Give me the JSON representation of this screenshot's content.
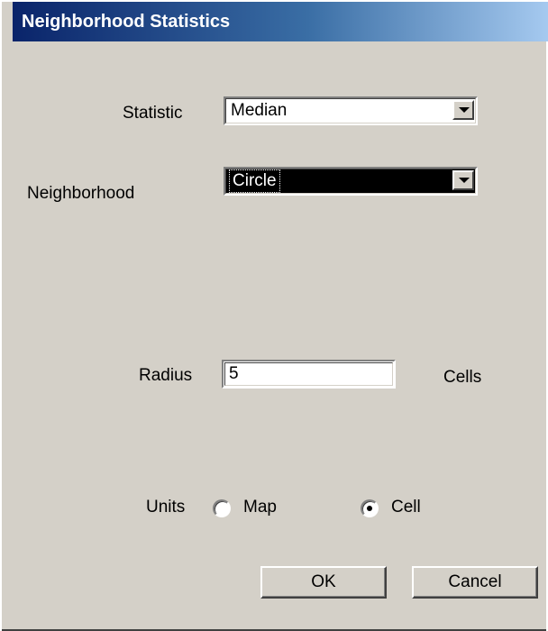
{
  "window": {
    "title": "Neighborhood Statistics"
  },
  "statistic": {
    "label": "Statistic",
    "value": "Median"
  },
  "neighborhood": {
    "label": "Neighborhood",
    "value": "Circle"
  },
  "radius": {
    "label": "Radius",
    "value": "5",
    "units_label": "Cells"
  },
  "units": {
    "label": "Units",
    "options": [
      {
        "label": "Map",
        "selected": false
      },
      {
        "label": "Cell",
        "selected": true
      }
    ]
  },
  "buttons": {
    "ok": "OK",
    "cancel": "Cancel"
  }
}
